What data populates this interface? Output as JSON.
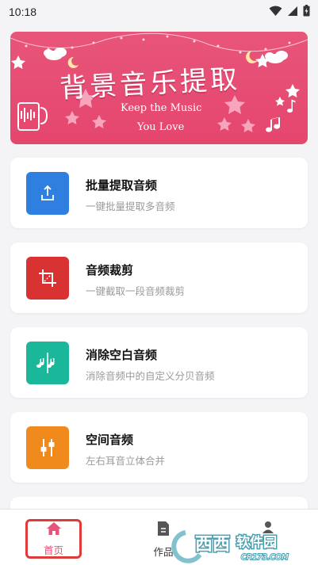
{
  "status_bar": {
    "time": "10:18"
  },
  "banner": {
    "title": "背景音乐提取",
    "subtitle_line1": "Keep the Music",
    "subtitle_line2": "You Love"
  },
  "features": [
    {
      "title": "批量提取音频",
      "desc": "一键批量提取多音频",
      "color": "#2f7fe0",
      "icon": "upload-icon"
    },
    {
      "title": "音频裁剪",
      "desc": "一键截取一段音频裁剪",
      "color": "#d93232",
      "icon": "crop-icon"
    },
    {
      "title": "消除空白音频",
      "desc": "消除音频中的自定义分贝音频",
      "color": "#1ab79a",
      "icon": "split-notes-icon"
    },
    {
      "title": "空间音频",
      "desc": "左右耳音立体合并",
      "color": "#f08a1c",
      "icon": "equalizer-icon"
    }
  ],
  "bottom_nav": {
    "home_label": "首页",
    "works_label": "作品"
  },
  "watermark": {
    "brand": "西西",
    "tagline": "软件园",
    "url": "CR173.COM"
  }
}
